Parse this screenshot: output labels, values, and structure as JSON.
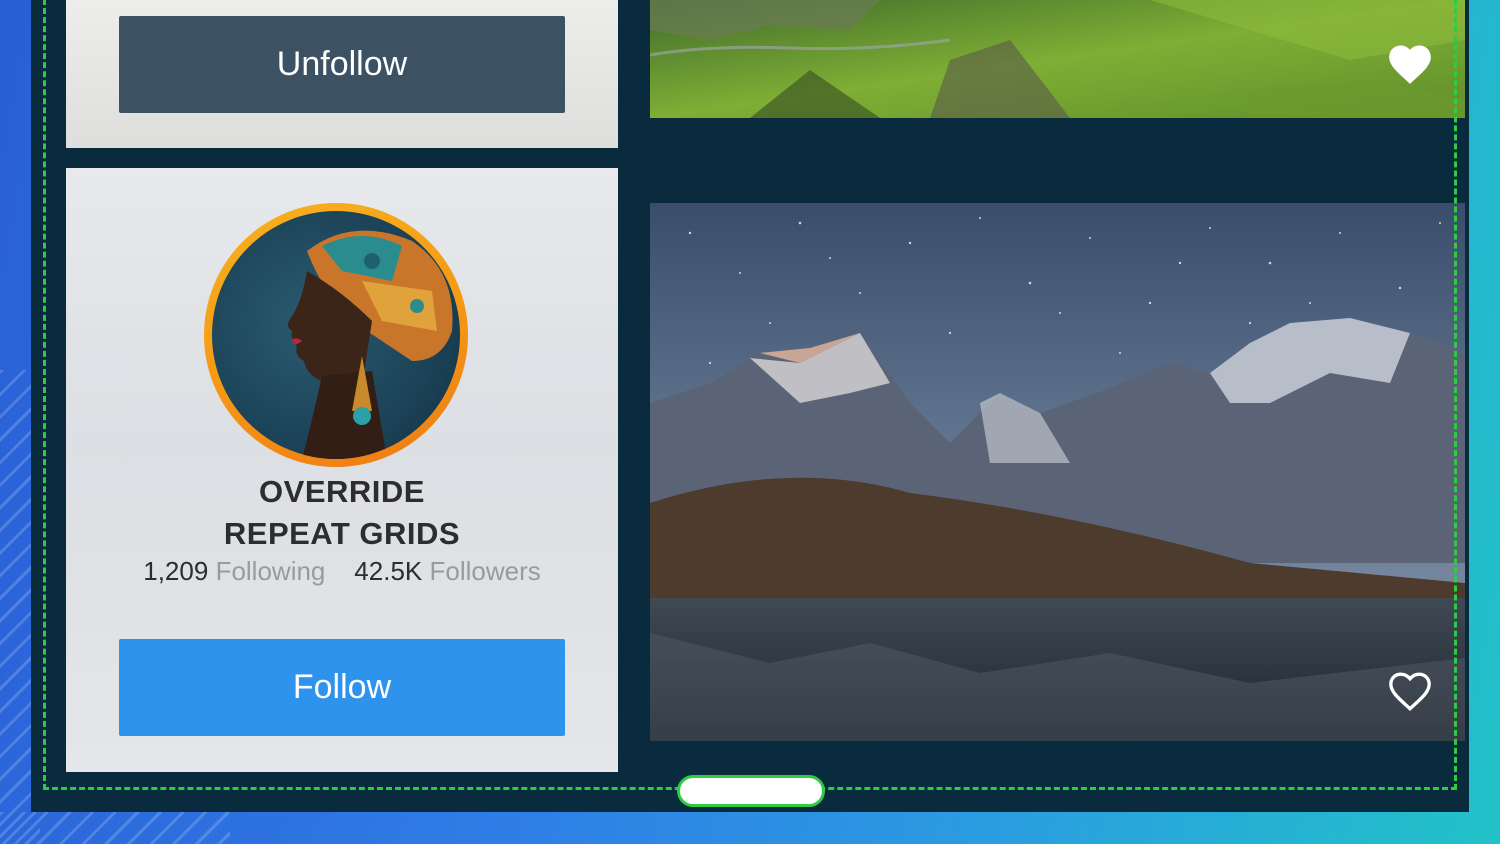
{
  "top_card": {
    "unfollow_label": "Unfollow"
  },
  "profile_card": {
    "name_line1": "OVERRIDE",
    "name_line2": "REPEAT GRIDS",
    "following_count": "1,209",
    "following_label": "Following",
    "followers_count": "42.5K",
    "followers_label": "Followers",
    "follow_label": "Follow"
  },
  "photos": [
    {
      "subject": "green highland cliffs",
      "liked": true,
      "icon": "heart-filled-icon"
    },
    {
      "subject": "starry sky over snowy mountains and lake",
      "liked": false,
      "icon": "heart-outline-icon"
    }
  ],
  "colors": {
    "accent_follow": "#2e93ec",
    "unfollow_button": "#3d5164",
    "frame_background": "#0a2a3d",
    "dashed_guide": "#2ecc40",
    "avatar_ring": "#f59a16"
  }
}
